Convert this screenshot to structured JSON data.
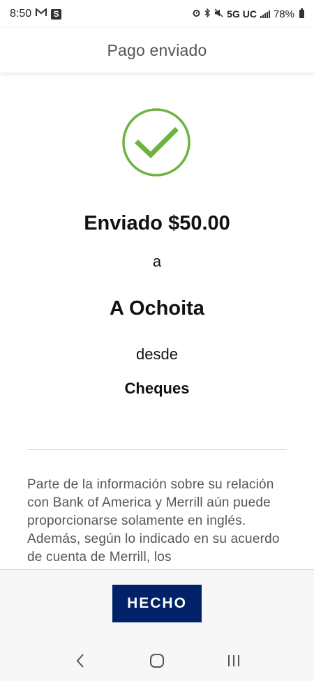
{
  "status_bar": {
    "time": "8:50",
    "network": "5G UC",
    "battery": "78%",
    "icons": [
      "gmail-icon",
      "s-app-icon",
      "alarm-icon",
      "bluetooth-icon",
      "mute-icon",
      "signal-icon",
      "battery-icon"
    ]
  },
  "header": {
    "title": "Pago enviado"
  },
  "confirmation": {
    "icon": "checkmark-circle-icon",
    "amount_line": "Enviado $50.00",
    "connector_to": "a",
    "recipient": "A Ochoita",
    "connector_from": "desde",
    "account": "Cheques"
  },
  "disclaimer": {
    "text": "Parte de la información sobre su relación con Bank of America y Merrill aún puede proporcionarse solamente en inglés. Además, según lo indicado en su acuerdo de cuenta de Merrill, los"
  },
  "footer": {
    "done_label": "HECHO"
  },
  "colors": {
    "success_green": "#6db33f",
    "brand_navy": "#012169",
    "header_text": "#555555"
  },
  "navbar": {
    "icons": [
      "back-icon",
      "home-icon",
      "recents-icon"
    ]
  }
}
